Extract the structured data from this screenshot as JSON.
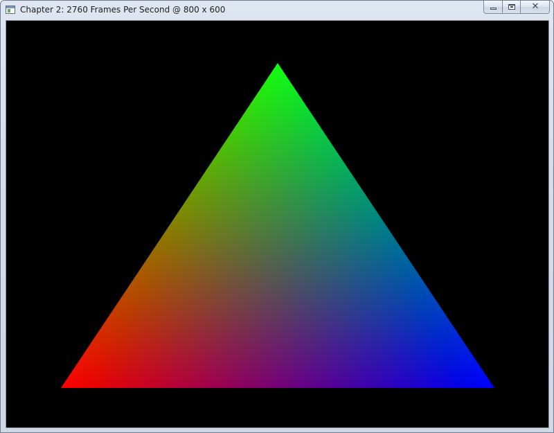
{
  "window": {
    "title": "Chapter 2: 2760 Frames Per Second @ 800 x 600",
    "icon": "application-window-icon",
    "caption_buttons": [
      "minimize-icon",
      "maximize-icon",
      "close-icon"
    ],
    "close_glyph": "✕"
  },
  "viewport": {
    "background_color": "#000000",
    "content": "rgb-interpolated-triangle",
    "vertex_colors": {
      "top": "#00ff00",
      "bottom_left": "#ff0000",
      "bottom_right": "#0000ff"
    }
  }
}
